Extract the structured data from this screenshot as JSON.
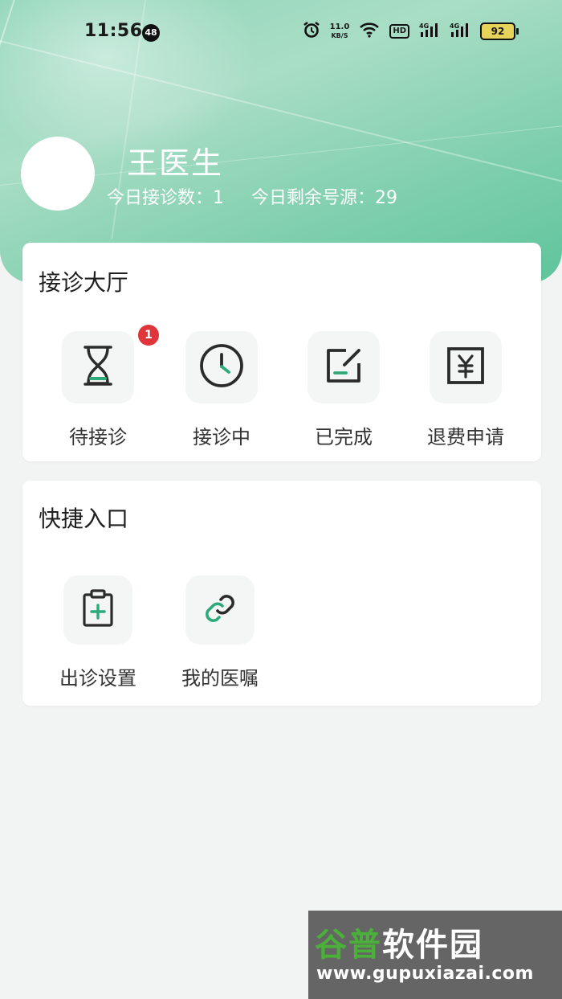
{
  "statusbar": {
    "time": "11:56",
    "notification_count": "48",
    "net_speed_value": "11.0",
    "net_speed_unit": "KB/S",
    "hd_label": "HD",
    "signal_label": "4G",
    "battery": "92"
  },
  "profile": {
    "name": "王医生",
    "today_visits_label": "今日接诊数：",
    "today_visits_value": "1",
    "remaining_label": "今日剩余号源：",
    "remaining_value": "29"
  },
  "reception_hall": {
    "title": "接诊大厅",
    "items": [
      {
        "label": "待接诊",
        "icon": "hourglass-icon",
        "badge": "1"
      },
      {
        "label": "接诊中",
        "icon": "clock-icon"
      },
      {
        "label": "已完成",
        "icon": "edit-check-icon"
      },
      {
        "label": "退费申请",
        "icon": "yuan-refund-icon"
      }
    ]
  },
  "shortcuts": {
    "title": "快捷入口",
    "items": [
      {
        "label": "出诊设置",
        "icon": "clipboard-plus-icon"
      },
      {
        "label": "我的医嘱",
        "icon": "link-icon"
      }
    ]
  },
  "watermark": {
    "brand_green": "谷普",
    "brand_white": "软件园",
    "url": "www.gupuxiazai.com"
  },
  "colors": {
    "accent": "#2daa7a",
    "header_green": "#7fcfae",
    "badge_red": "#e0353a"
  }
}
